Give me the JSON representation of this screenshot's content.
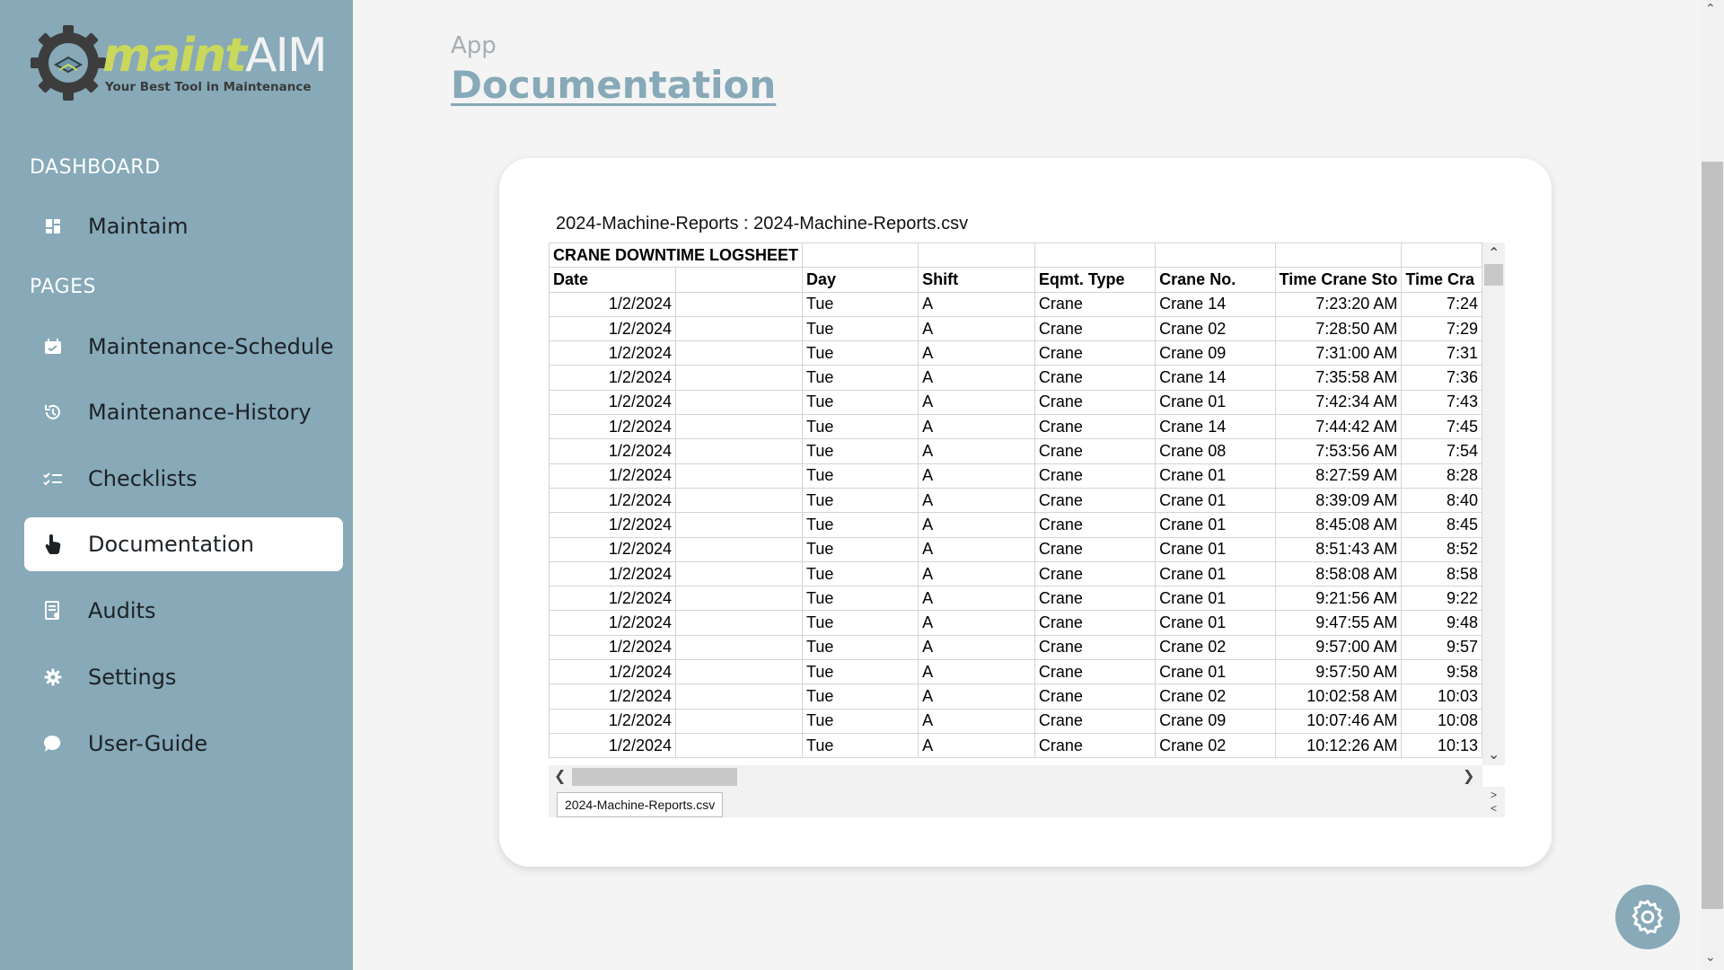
{
  "brand": {
    "word1": "maint",
    "word2": "AIM",
    "tagline": "Your Best Tool in Maintenance"
  },
  "sidebar": {
    "sections": {
      "dashboard": "DASHBOARD",
      "pages": "PAGES"
    },
    "items": [
      {
        "label": "Maintaim",
        "icon": "dashboard-icon"
      },
      {
        "label": "Maintenance-Schedule",
        "icon": "calendar-icon"
      },
      {
        "label": "Maintenance-History",
        "icon": "history-icon"
      },
      {
        "label": "Checklists",
        "icon": "checklist-icon"
      },
      {
        "label": "Documentation",
        "icon": "hand-pointer-icon",
        "active": true
      },
      {
        "label": "Audits",
        "icon": "audit-icon"
      },
      {
        "label": "Settings",
        "icon": "gear-icon"
      },
      {
        "label": "User-Guide",
        "icon": "chat-bubble-icon"
      }
    ]
  },
  "header": {
    "breadcrumb": "App",
    "title": "Documentation"
  },
  "viewer": {
    "file_title": "2024-Machine-Reports : 2024-Machine-Reports.csv",
    "sheet_tab": "2024-Machine-Reports.csv",
    "logsheet_title": "CRANE DOWNTIME LOGSHEET",
    "columns": [
      "Date",
      "",
      "Day",
      "Shift",
      "Eqmt. Type",
      "Crane No.",
      "Time Crane Sto",
      "Time Cra"
    ],
    "rows": [
      [
        "1/2/2024",
        "",
        "Tue",
        "A",
        "Crane",
        "Crane 14",
        "7:23:20 AM",
        "7:24"
      ],
      [
        "1/2/2024",
        "",
        "Tue",
        "A",
        "Crane",
        "Crane 02",
        "7:28:50 AM",
        "7:29"
      ],
      [
        "1/2/2024",
        "",
        "Tue",
        "A",
        "Crane",
        "Crane 09",
        "7:31:00 AM",
        "7:31"
      ],
      [
        "1/2/2024",
        "",
        "Tue",
        "A",
        "Crane",
        "Crane 14",
        "7:35:58 AM",
        "7:36"
      ],
      [
        "1/2/2024",
        "",
        "Tue",
        "A",
        "Crane",
        "Crane 01",
        "7:42:34 AM",
        "7:43"
      ],
      [
        "1/2/2024",
        "",
        "Tue",
        "A",
        "Crane",
        "Crane 14",
        "7:44:42 AM",
        "7:45"
      ],
      [
        "1/2/2024",
        "",
        "Tue",
        "A",
        "Crane",
        "Crane 08",
        "7:53:56 AM",
        "7:54"
      ],
      [
        "1/2/2024",
        "",
        "Tue",
        "A",
        "Crane",
        "Crane 01",
        "8:27:59 AM",
        "8:28"
      ],
      [
        "1/2/2024",
        "",
        "Tue",
        "A",
        "Crane",
        "Crane 01",
        "8:39:09 AM",
        "8:40"
      ],
      [
        "1/2/2024",
        "",
        "Tue",
        "A",
        "Crane",
        "Crane 01",
        "8:45:08 AM",
        "8:45"
      ],
      [
        "1/2/2024",
        "",
        "Tue",
        "A",
        "Crane",
        "Crane 01",
        "8:51:43 AM",
        "8:52"
      ],
      [
        "1/2/2024",
        "",
        "Tue",
        "A",
        "Crane",
        "Crane 01",
        "8:58:08 AM",
        "8:58"
      ],
      [
        "1/2/2024",
        "",
        "Tue",
        "A",
        "Crane",
        "Crane 01",
        "9:21:56 AM",
        "9:22"
      ],
      [
        "1/2/2024",
        "",
        "Tue",
        "A",
        "Crane",
        "Crane 01",
        "9:47:55 AM",
        "9:48"
      ],
      [
        "1/2/2024",
        "",
        "Tue",
        "A",
        "Crane",
        "Crane 02",
        "9:57:00 AM",
        "9:57"
      ],
      [
        "1/2/2024",
        "",
        "Tue",
        "A",
        "Crane",
        "Crane 01",
        "9:57:50 AM",
        "9:58"
      ],
      [
        "1/2/2024",
        "",
        "Tue",
        "A",
        "Crane",
        "Crane 02",
        "10:02:58 AM",
        "10:03"
      ],
      [
        "1/2/2024",
        "",
        "Tue",
        "A",
        "Crane",
        "Crane 09",
        "10:07:46 AM",
        "10:08"
      ],
      [
        "1/2/2024",
        "",
        "Tue",
        "A",
        "Crane",
        "Crane 02",
        "10:12:26 AM",
        "10:13"
      ]
    ]
  },
  "colors": {
    "sidebar": "#87a9b8",
    "accent": "#87a9b8",
    "background": "#f3f4f3"
  }
}
